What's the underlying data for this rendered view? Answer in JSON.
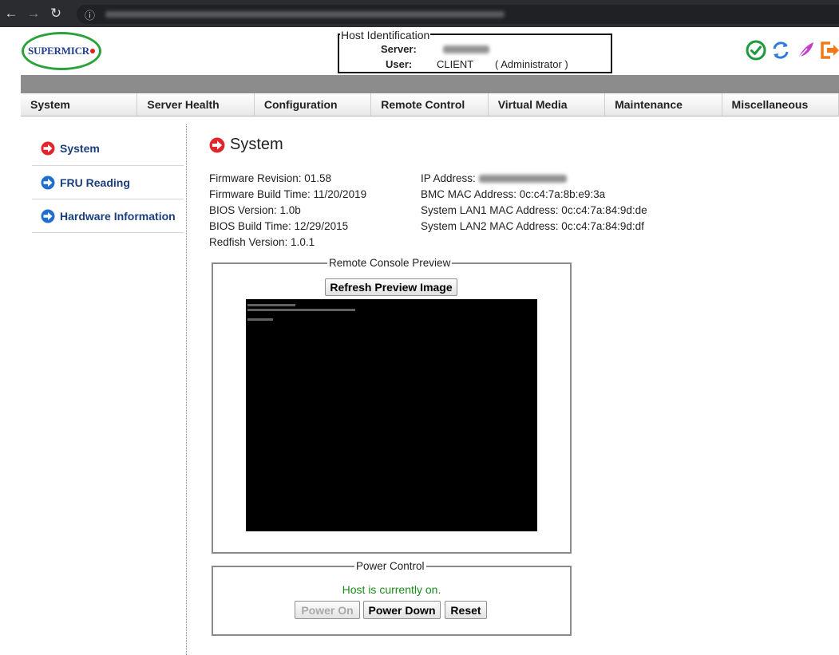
{
  "header": {
    "logo_text": "SUPERMICR",
    "host_identification": {
      "legend": "Host Identification",
      "server_label": "Server:",
      "user_label": "User:",
      "user_value": "CLIENT",
      "role": "( Administrator )"
    }
  },
  "menu": {
    "items": [
      "System",
      "Server Health",
      "Configuration",
      "Remote Control",
      "Virtual Media",
      "Maintenance",
      "Miscellaneous"
    ]
  },
  "sidebar": {
    "items": [
      "System",
      "FRU Reading",
      "Hardware Information"
    ]
  },
  "main": {
    "title": "System",
    "left_info": [
      "Firmware Revision: 01.58",
      "Firmware Build Time: 11/20/2019",
      "BIOS Version: 1.0b",
      "BIOS Build Time: 12/29/2015",
      "Redfish Version: 1.0.1"
    ],
    "right_info": {
      "ip_label": "IP Address:",
      "lines": [
        "BMC MAC Address: 0c:c4:7a:8b:e9:3a",
        "System LAN1 MAC Address: 0c:c4:7a:84:9d:de",
        "System LAN2 MAC Address: 0c:c4:7a:84:9d:df"
      ]
    },
    "console": {
      "legend": "Remote Console Preview",
      "refresh_label": "Refresh Preview Image"
    },
    "power": {
      "legend": "Power Control",
      "status": "Host is currently on.",
      "power_on_label": "Power On",
      "power_down_label": "Power Down",
      "reset_label": "Reset"
    }
  },
  "colors": {
    "accent_red": "#e0262b",
    "accent_blue": "#1f6fcf",
    "status_green": "#1c8b1c",
    "menu_band": "#8c8c8c"
  },
  "icons": [
    "back-icon",
    "forward-icon",
    "reload-icon",
    "info-icon",
    "check-circle-icon",
    "refresh-icon",
    "feather-icon",
    "logout-icon"
  ]
}
